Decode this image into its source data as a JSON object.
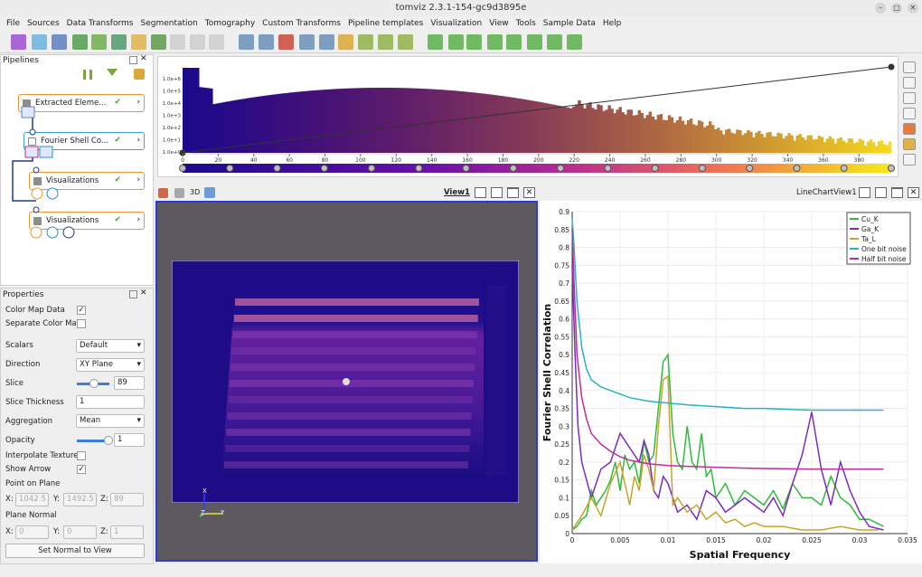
{
  "window": {
    "title": "tomviz 2.3.1-154-gc9d3895e"
  },
  "menu": [
    "File",
    "Sources",
    "Data Transforms",
    "Segmentation",
    "Tomography",
    "Custom Transforms",
    "Pipeline templates",
    "Visualization",
    "View",
    "Tools",
    "Sample Data",
    "Help"
  ],
  "pipelines": {
    "title": "Pipelines",
    "items": [
      {
        "label": "Extracted Eleme...",
        "border": "#e8962f"
      },
      {
        "label": "Fourier Shell Co...",
        "border": "#3f9fd8"
      },
      {
        "label": "Visualizations",
        "border": "#e8962f"
      },
      {
        "label": "Visualizations",
        "border": "#e8962f"
      }
    ]
  },
  "histogram": {
    "ylabels": [
      "1.0e+6",
      "1.0e+5",
      "1.0e+4",
      "1.0e+3",
      "1.0e+2",
      "1.0e+1",
      "1.0e+0"
    ],
    "xticks": [
      "0",
      "20",
      "40",
      "60",
      "80",
      "100",
      "120",
      "140",
      "160",
      "180",
      "200",
      "220",
      "240",
      "260",
      "280",
      "300",
      "320",
      "340",
      "360",
      "380"
    ]
  },
  "properties": {
    "title": "Properties",
    "color_map_data": "Color Map Data",
    "separate_color_map": "Separate Color Map",
    "scalars_label": "Scalars",
    "scalars_value": "Default",
    "direction_label": "Direction",
    "direction_value": "XY Plane",
    "slice_label": "Slice",
    "slice_value": "89",
    "slice_thickness_label": "Slice Thickness",
    "slice_thickness_value": "1",
    "aggregation_label": "Aggregation",
    "aggregation_value": "Mean",
    "opacity_label": "Opacity",
    "opacity_value": "1",
    "interpolate_label": "Interpolate Texture",
    "show_arrow_label": "Show Arrow",
    "point_on_plane": "Point on Plane",
    "point_x": "1042.5",
    "point_y": "1492.5",
    "point_z": "89",
    "plane_normal": "Plane Normal",
    "normal_x": "0",
    "normal_y": "0",
    "normal_z": "1",
    "x_lbl": "X:",
    "y_lbl": "Y:",
    "z_lbl": "Z:",
    "set_normal_button": "Set Normal to View"
  },
  "view3d": {
    "title": "View1",
    "mode": "3D",
    "axis_x": "X",
    "axis_y": "Y",
    "axis_z": "Z"
  },
  "lineview": {
    "title": "LineChartView1"
  },
  "chart_data": {
    "type": "line",
    "xlabel": "Spatial Frequency",
    "ylabel": "Fourier Shell Correlation",
    "xlim": [
      0,
      0.035
    ],
    "ylim": [
      0,
      0.9
    ],
    "xticks": [
      "0",
      "0.005",
      "0.01",
      "0.015",
      "0.02",
      "0.025",
      "0.03",
      "0.035"
    ],
    "yticks": [
      "0",
      "0.05",
      "0.1",
      "0.15",
      "0.2",
      "0.25",
      "0.3",
      "0.35",
      "0.4",
      "0.45",
      "0.5",
      "0.55",
      "0.6",
      "0.65",
      "0.7",
      "0.75",
      "0.8",
      "0.85",
      "0.9"
    ],
    "series": [
      {
        "name": "Cu_K",
        "color": "#2ebd3b",
        "x": [
          0,
          0.0005,
          0.001,
          0.0015,
          0.002,
          0.0025,
          0.003,
          0.0035,
          0.004,
          0.0045,
          0.005,
          0.0055,
          0.006,
          0.0065,
          0.007,
          0.0075,
          0.008,
          0.0085,
          0.009,
          0.0095,
          0.01,
          0.0105,
          0.011,
          0.0115,
          0.012,
          0.0125,
          0.013,
          0.0135,
          0.014,
          0.0145,
          0.015,
          0.016,
          0.017,
          0.018,
          0.019,
          0.02,
          0.021,
          0.022,
          0.023,
          0.024,
          0.025,
          0.026,
          0.027,
          0.028,
          0.029,
          0.03,
          0.031,
          0.0325
        ],
        "y": [
          0.01,
          0.02,
          0.04,
          0.05,
          0.12,
          0.08,
          0.1,
          0.12,
          0.15,
          0.2,
          0.12,
          0.22,
          0.18,
          0.2,
          0.14,
          0.26,
          0.2,
          0.22,
          0.35,
          0.48,
          0.5,
          0.28,
          0.2,
          0.18,
          0.3,
          0.2,
          0.18,
          0.28,
          0.16,
          0.18,
          0.1,
          0.14,
          0.08,
          0.12,
          0.1,
          0.08,
          0.12,
          0.07,
          0.14,
          0.1,
          0.1,
          0.08,
          0.16,
          0.1,
          0.08,
          0.04,
          0.04,
          0.02
        ]
      },
      {
        "name": "Ga_K",
        "color": "#7a2dbf",
        "x": [
          0,
          0.0003,
          0.0006,
          0.001,
          0.0015,
          0.002,
          0.003,
          0.004,
          0.005,
          0.006,
          0.007,
          0.0075,
          0.008,
          0.0085,
          0.009,
          0.0095,
          0.01,
          0.011,
          0.012,
          0.013,
          0.014,
          0.015,
          0.016,
          0.017,
          0.018,
          0.019,
          0.02,
          0.021,
          0.022,
          0.023,
          0.024,
          0.025,
          0.026,
          0.027,
          0.028,
          0.029,
          0.03,
          0.031,
          0.0325
        ],
        "y": [
          0.75,
          0.5,
          0.3,
          0.2,
          0.15,
          0.1,
          0.18,
          0.2,
          0.28,
          0.24,
          0.2,
          0.26,
          0.22,
          0.12,
          0.1,
          0.16,
          0.14,
          0.06,
          0.08,
          0.04,
          0.12,
          0.1,
          0.06,
          0.08,
          0.1,
          0.08,
          0.06,
          0.1,
          0.05,
          0.14,
          0.22,
          0.34,
          0.18,
          0.08,
          0.2,
          0.12,
          0.06,
          0.02,
          0.01
        ]
      },
      {
        "name": "Ta_L",
        "color": "#c8a42a",
        "x": [
          0,
          0.001,
          0.002,
          0.003,
          0.004,
          0.005,
          0.006,
          0.0065,
          0.007,
          0.0075,
          0.008,
          0.0085,
          0.009,
          0.0095,
          0.01,
          0.0105,
          0.011,
          0.012,
          0.013,
          0.014,
          0.015,
          0.016,
          0.017,
          0.018,
          0.019,
          0.02,
          0.022,
          0.024,
          0.026,
          0.028,
          0.03,
          0.032
        ],
        "y": [
          0.01,
          0.05,
          0.1,
          0.05,
          0.14,
          0.2,
          0.08,
          0.16,
          0.12,
          0.22,
          0.18,
          0.12,
          0.3,
          0.43,
          0.44,
          0.08,
          0.1,
          0.06,
          0.08,
          0.04,
          0.06,
          0.03,
          0.04,
          0.02,
          0.03,
          0.02,
          0.02,
          0.01,
          0.01,
          0.02,
          0.01,
          0.01
        ]
      },
      {
        "name": "One bit noise",
        "color": "#26b3c7",
        "x": [
          0,
          0.0002,
          0.0005,
          0.001,
          0.0015,
          0.002,
          0.003,
          0.004,
          0.005,
          0.006,
          0.008,
          0.01,
          0.012,
          0.015,
          0.018,
          0.02,
          0.025,
          0.03,
          0.0325
        ],
        "y": [
          0.88,
          0.8,
          0.65,
          0.52,
          0.46,
          0.43,
          0.41,
          0.4,
          0.39,
          0.38,
          0.37,
          0.365,
          0.36,
          0.355,
          0.35,
          0.35,
          0.345,
          0.345,
          0.345
        ]
      },
      {
        "name": "Half bit noise",
        "color": "#c02ca0",
        "x": [
          0,
          0.0002,
          0.0005,
          0.001,
          0.0015,
          0.002,
          0.003,
          0.004,
          0.005,
          0.006,
          0.008,
          0.01,
          0.012,
          0.015,
          0.018,
          0.02,
          0.025,
          0.03,
          0.0325
        ],
        "y": [
          0.85,
          0.7,
          0.5,
          0.38,
          0.32,
          0.28,
          0.25,
          0.23,
          0.215,
          0.205,
          0.195,
          0.19,
          0.188,
          0.185,
          0.183,
          0.182,
          0.18,
          0.18,
          0.18
        ]
      }
    ]
  }
}
